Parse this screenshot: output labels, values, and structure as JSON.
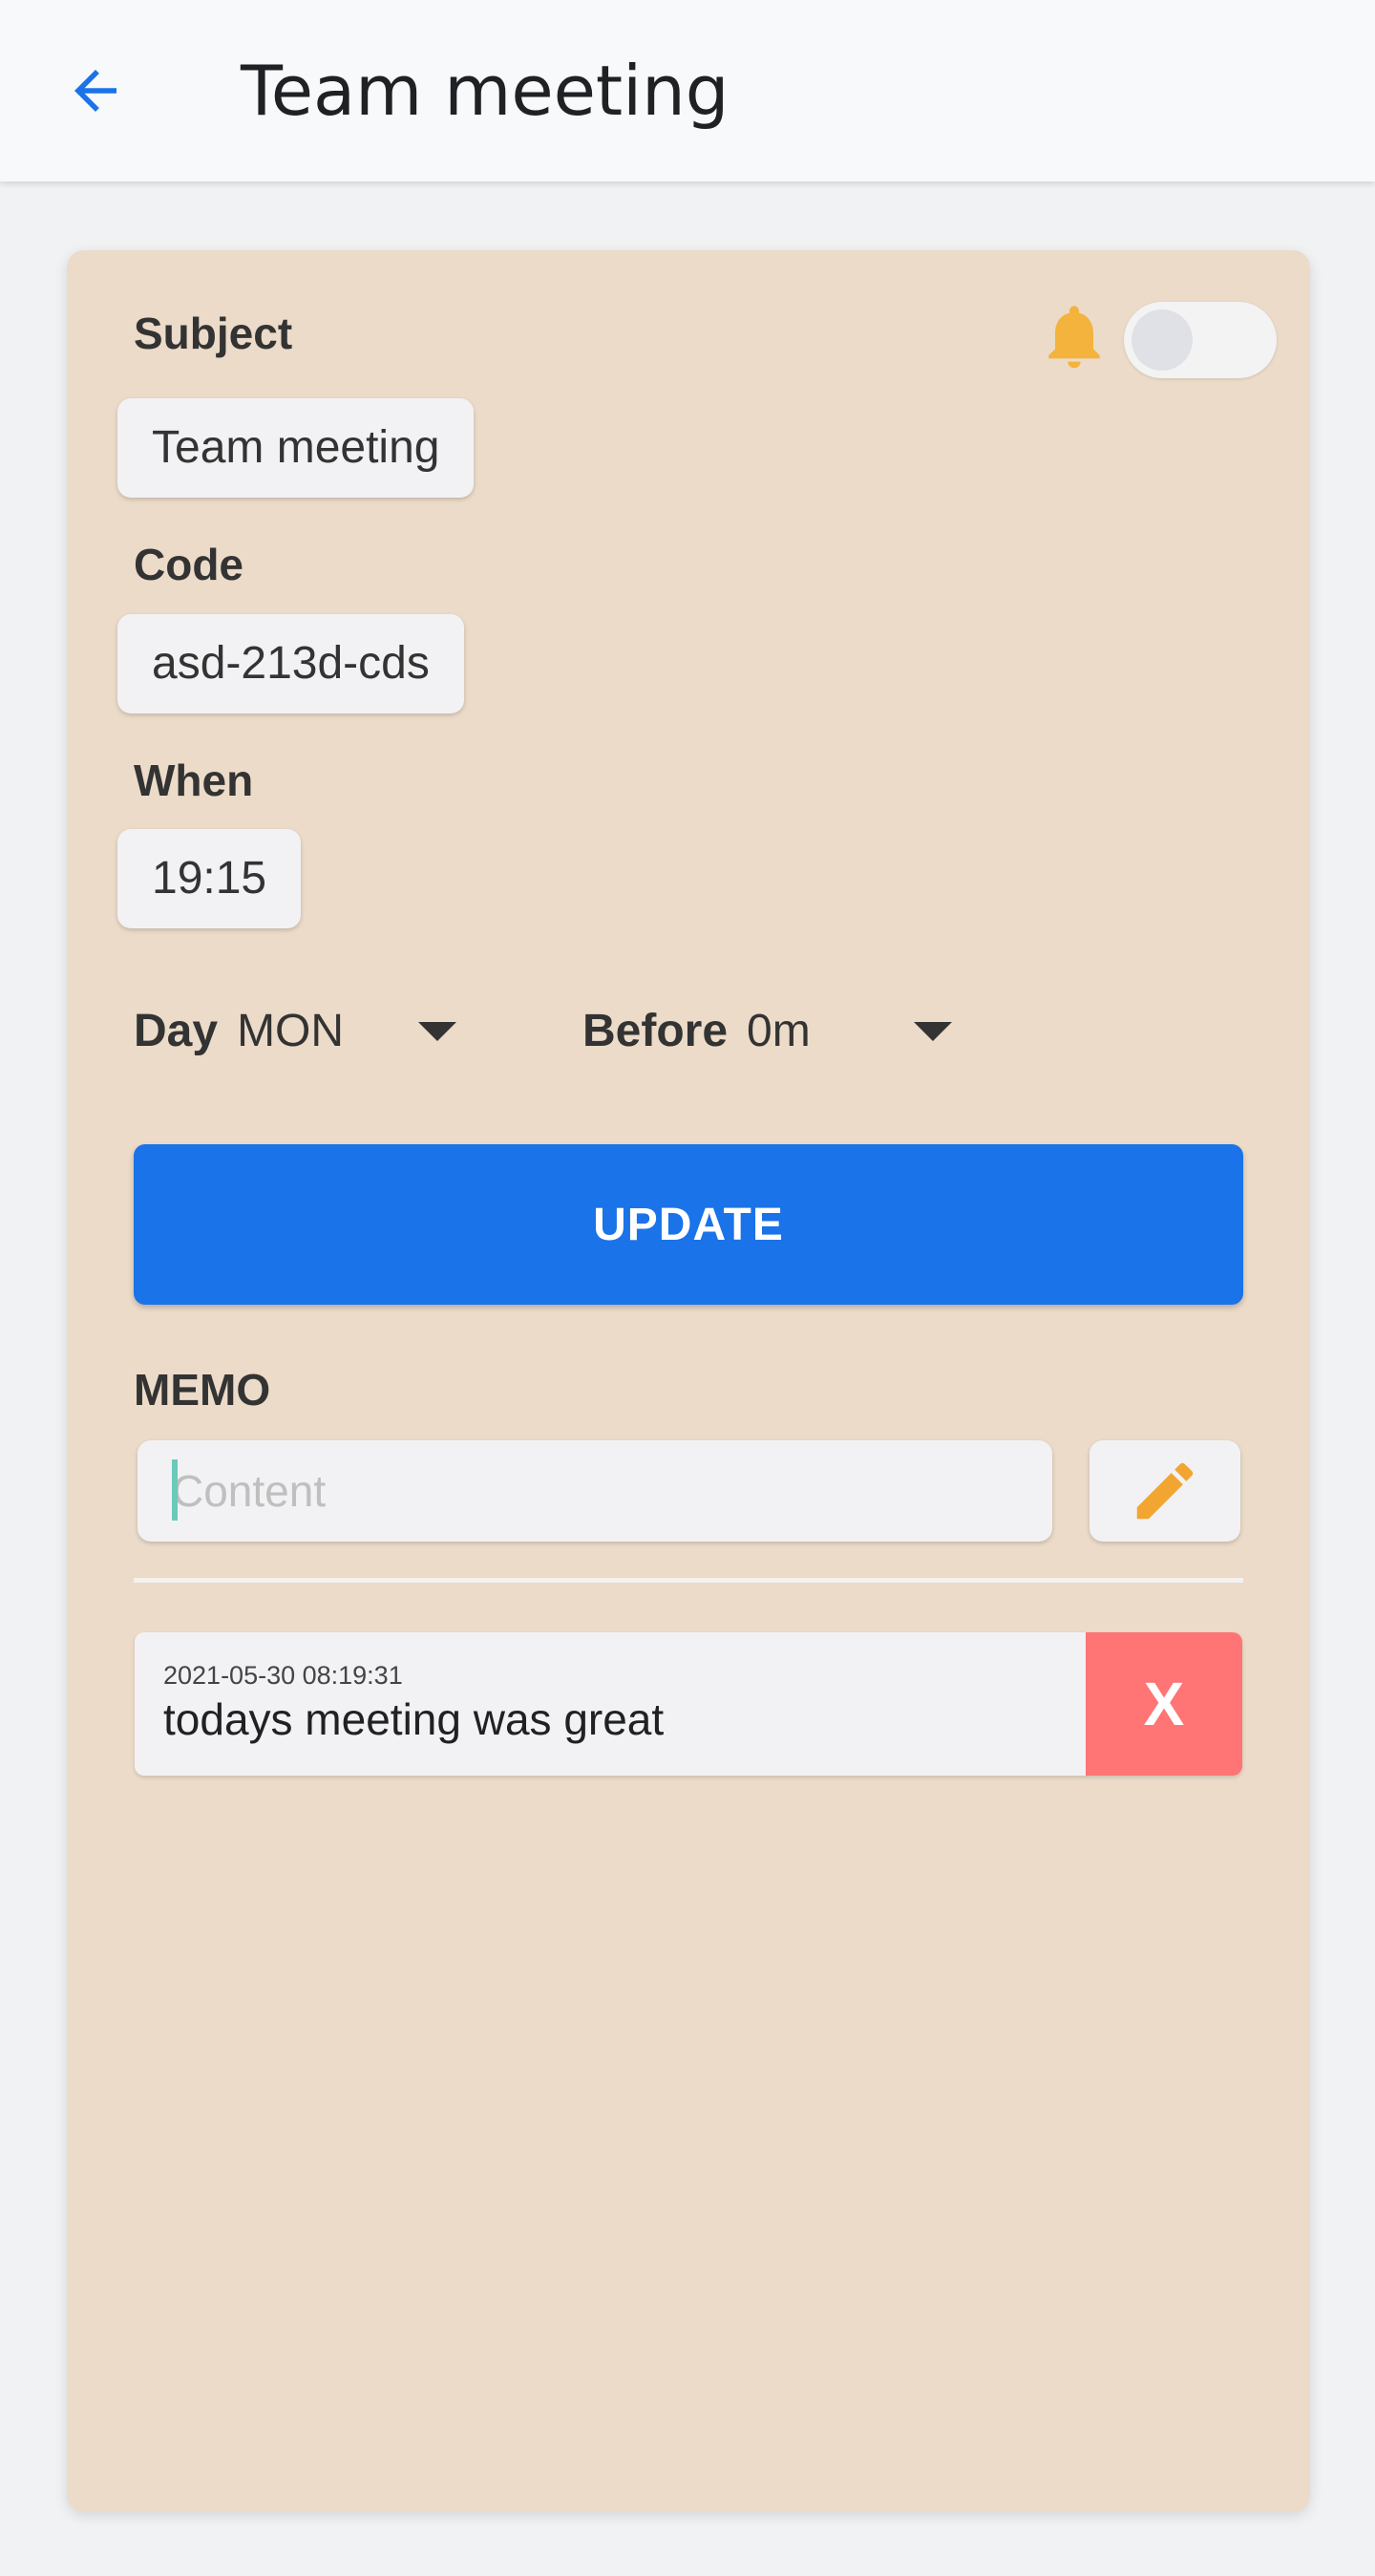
{
  "header": {
    "title": "Team meeting",
    "back_icon": "arrow-back-icon",
    "accent_color": "#1a73e8"
  },
  "form": {
    "subject_label": "Subject",
    "subject_value": "Team meeting",
    "code_label": "Code",
    "code_value": "asd-213d-cds",
    "when_label": "When",
    "when_value": "19:15",
    "day_label": "Day",
    "day_value": "MON",
    "before_label": "Before",
    "before_value": "0m",
    "alarm_icon": "bell-icon",
    "alarm_enabled": false,
    "update_label": "UPDATE"
  },
  "memo": {
    "label": "MEMO",
    "input_placeholder": "Content",
    "edit_icon": "pencil-icon",
    "items": [
      {
        "timestamp": "2021-05-30 08:19:31",
        "text": "todays meeting was great",
        "delete_label": "X"
      }
    ]
  },
  "colors": {
    "card_background": "#ecdbc9",
    "bell": "#f3b33d",
    "delete": "#ff7474"
  }
}
